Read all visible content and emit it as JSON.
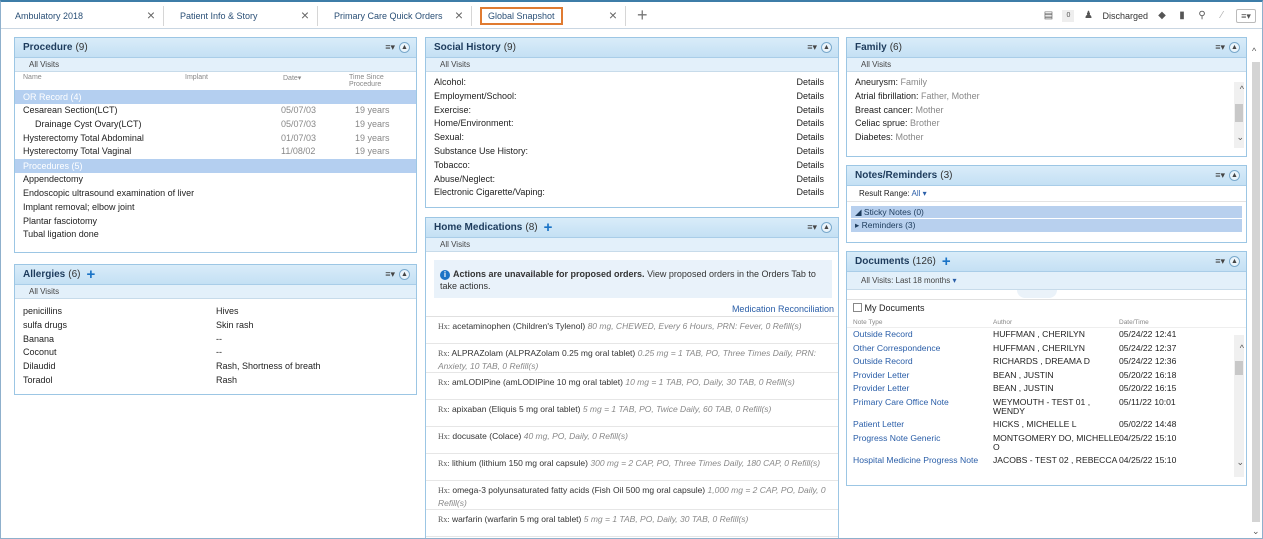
{
  "tabs": [
    {
      "label": "Ambulatory 2018"
    },
    {
      "label": "Patient Info & Story"
    },
    {
      "label": "Primary Care Quick Orders"
    },
    {
      "label": "Global Snapshot"
    }
  ],
  "toolbar": {
    "status": "Discharged",
    "badge": "0"
  },
  "procedure": {
    "title": "Procedure",
    "count": "(9)",
    "filter": "All Visits",
    "cols": {
      "name": "Name",
      "implant": "Implant",
      "date": "Date",
      "since": "Time Since Procedure"
    },
    "group1": "OR Record (4)",
    "rows1": [
      {
        "name": "Cesarean Section(LCT)",
        "date": "05/07/03",
        "since": "19 years"
      },
      {
        "name": "Drainage Cyst Ovary(LCT)",
        "date": "05/07/03",
        "since": "19 years"
      },
      {
        "name": "Hysterectomy Total Abdominal",
        "date": "01/07/03",
        "since": "19 years"
      },
      {
        "name": "Hysterectomy Total Vaginal",
        "date": "11/08/02",
        "since": "19 years"
      }
    ],
    "group2": "Procedures (5)",
    "rows2": [
      {
        "name": "Appendectomy"
      },
      {
        "name": "Endoscopic ultrasound examination of liver"
      },
      {
        "name": "Implant removal; elbow joint"
      },
      {
        "name": "Plantar fasciotomy"
      },
      {
        "name": "Tubal ligation done"
      }
    ]
  },
  "allergies": {
    "title": "Allergies",
    "count": "(6)",
    "filter": "All Visits",
    "rows": [
      {
        "name": "penicillins",
        "reaction": "Hives"
      },
      {
        "name": "sulfa drugs",
        "reaction": "Skin rash"
      },
      {
        "name": "Banana",
        "reaction": "--"
      },
      {
        "name": "Coconut",
        "reaction": "--"
      },
      {
        "name": "Dilaudid",
        "reaction": "Rash, Shortness of breath"
      },
      {
        "name": "Toradol",
        "reaction": "Rash"
      }
    ]
  },
  "social": {
    "title": "Social History",
    "count": "(9)",
    "filter": "All Visits",
    "rows": [
      {
        "name": "Alcohol:",
        "action": "Details"
      },
      {
        "name": "Employment/School:",
        "action": "Details"
      },
      {
        "name": "Exercise:",
        "action": "Details"
      },
      {
        "name": "Home/Environment:",
        "action": "Details"
      },
      {
        "name": "Sexual:",
        "action": "Details"
      },
      {
        "name": "Substance Use History:",
        "action": "Details"
      },
      {
        "name": "Tobacco:",
        "action": "Details"
      },
      {
        "name": "Abuse/Neglect:",
        "action": "Details"
      },
      {
        "name": "Electronic Cigarette/Vaping:",
        "action": "Details"
      }
    ]
  },
  "homemeds": {
    "title": "Home Medications",
    "count": "(8)",
    "filter": "All Visits",
    "info_bold": "Actions are unavailable for proposed orders.",
    "info_rest": "View proposed orders in the Orders Tab to take actions.",
    "reconcile": "Medication Reconciliation",
    "meds": [
      {
        "rx": "Hx:",
        "name": "acetaminophen (Children's Tylenol)",
        "detail": "80 mg, CHEWED, Every 6 Hours, PRN: Fever, 0 Refill(s)"
      },
      {
        "rx": "Rx:",
        "name": "ALPRAZolam (ALPRAZolam 0.25 mg oral tablet)",
        "detail": "0.25 mg = 1 TAB, PO, Three Times Daily, PRN: Anxiety, 10 TAB, 0 Refill(s)"
      },
      {
        "rx": "Rx:",
        "name": "amLODIPine (amLODIPine 10 mg oral tablet)",
        "detail": "10 mg = 1 TAB, PO, Daily, 30 TAB, 0 Refill(s)"
      },
      {
        "rx": "Rx:",
        "name": "apixaban (Eliquis 5 mg oral tablet)",
        "detail": "5 mg = 1 TAB, PO, Twice Daily, 60 TAB, 0 Refill(s)"
      },
      {
        "rx": "Hx:",
        "name": "docusate (Colace)",
        "detail": "40 mg, PO, Daily, 0 Refill(s)"
      },
      {
        "rx": "Rx:",
        "name": "lithium (lithium 150 mg oral capsule)",
        "detail": "300 mg = 2 CAP, PO, Three Times Daily, 180 CAP, 0 Refill(s)"
      },
      {
        "rx": "Hx:",
        "name": "omega-3 polyunsaturated fatty acids (Fish Oil 500 mg oral capsule)",
        "detail": "1,000 mg = 2 CAP, PO, Daily, 0 Refill(s)"
      },
      {
        "rx": "Rx:",
        "name": "warfarin (warfarin 5 mg oral tablet)",
        "detail": "5 mg = 1 TAB, PO, Daily, 30 TAB, 0 Refill(s)"
      }
    ]
  },
  "family": {
    "title": "Family",
    "count": "(6)",
    "filter": "All Visits",
    "rows": [
      {
        "name": "Aneurysm:",
        "who": "Family"
      },
      {
        "name": "Atrial fibrillation:",
        "who": "Father, Mother"
      },
      {
        "name": "Breast cancer:",
        "who": "Mother"
      },
      {
        "name": "Celiac sprue:",
        "who": "Brother"
      },
      {
        "name": "Diabetes:",
        "who": "Mother"
      }
    ]
  },
  "notes": {
    "title": "Notes/Reminders",
    "count": "(3)",
    "range_label": "Result Range:",
    "range_value": "All",
    "sticky": "Sticky Notes (0)",
    "reminders": "Reminders (3)"
  },
  "documents": {
    "title": "Documents",
    "count": "(126)",
    "filter": "All Visits: Last 18 months",
    "mydocs": "My Documents",
    "cols": {
      "type": "Note Type",
      "author": "Author",
      "date": "Date/Time"
    },
    "rows": [
      {
        "type": "Outside Record",
        "author": "HUFFMAN , CHERILYN",
        "date": "05/24/22 12:41"
      },
      {
        "type": "Other Correspondence",
        "author": "HUFFMAN , CHERILYN",
        "date": "05/24/22 12:37"
      },
      {
        "type": "Outside Record",
        "author": "RICHARDS , DREAMA D",
        "date": "05/24/22 12:36"
      },
      {
        "type": "Provider Letter",
        "author": "BEAN , JUSTIN",
        "date": "05/20/22 16:18"
      },
      {
        "type": "Provider Letter",
        "author": "BEAN , JUSTIN",
        "date": "05/20/22 16:15"
      },
      {
        "type": "Primary Care Office Note",
        "author": "WEYMOUTH - TEST 01 ,",
        "author2": "WENDY",
        "date": "05/11/22 10:01"
      },
      {
        "type": "Patient Letter",
        "author": "HICKS , MICHELLE L",
        "date": "05/02/22 14:48"
      },
      {
        "type": "Progress Note Generic",
        "author": "MONTGOMERY DO, MICHELLE",
        "author2": "O",
        "date": "04/25/22 15:10"
      },
      {
        "type": "Hospital Medicine Progress Note",
        "author": "JACOBS - TEST 02 , REBECCA",
        "date": "04/25/22 15:10"
      }
    ]
  }
}
